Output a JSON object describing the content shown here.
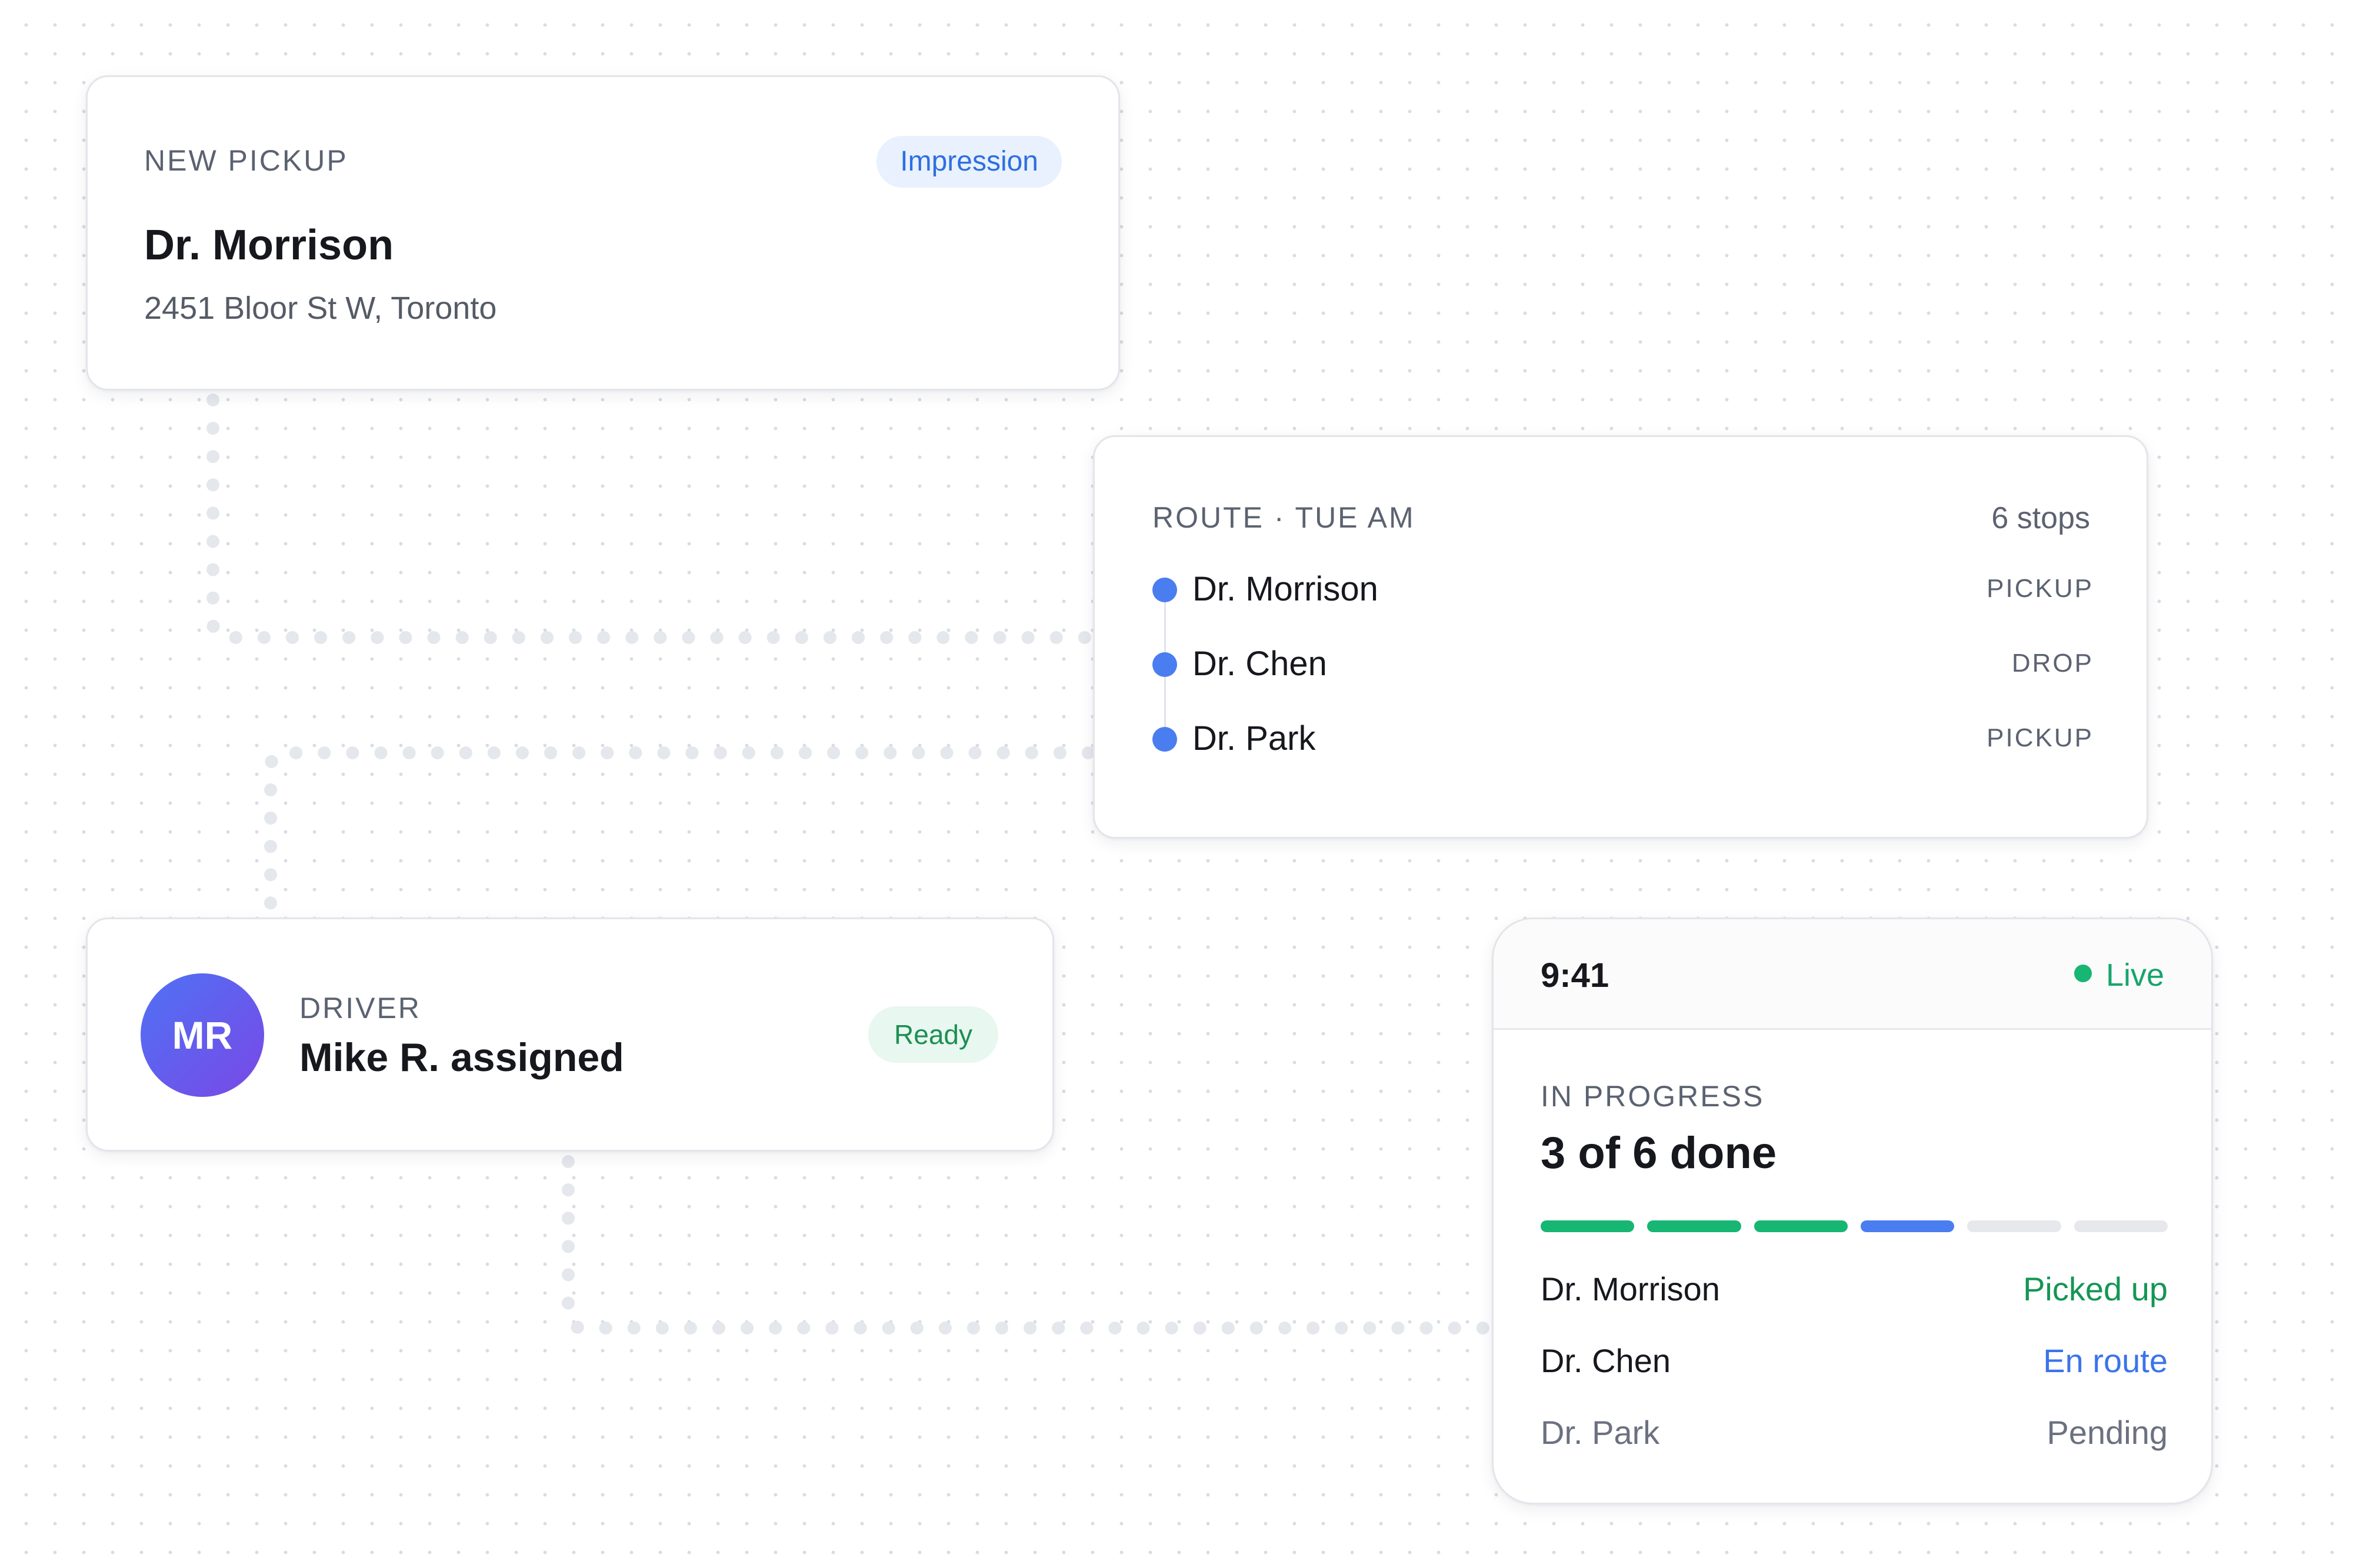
{
  "colors": {
    "accent_blue": "#4a7ef0",
    "success_green": "#17b673",
    "pill_blue_bg": "#e8f1fd",
    "pill_green_bg": "#e8f7ef",
    "avatar_gradient": [
      "#4e72f4",
      "#7a48e6"
    ]
  },
  "pickup_card": {
    "eyebrow": "NEW PICKUP",
    "badge": "Impression",
    "title": "Dr. Morrison",
    "address": "2451 Bloor St W, Toronto"
  },
  "route_card": {
    "eyebrow": "ROUTE · TUE AM",
    "count": "6 stops",
    "stops": [
      {
        "name": "Dr. Morrison",
        "type": "PICKUP"
      },
      {
        "name": "Dr. Chen",
        "type": "DROP"
      },
      {
        "name": "Dr. Park",
        "type": "PICKUP"
      }
    ]
  },
  "driver_card": {
    "avatar_initials": "MR",
    "eyebrow": "DRIVER",
    "title": "Mike R. assigned",
    "badge": "Ready"
  },
  "progress_card": {
    "time": "9:41",
    "live_label": "Live",
    "eyebrow": "IN PROGRESS",
    "title": "3 of 6 done",
    "progress": {
      "done": 3,
      "active": 1,
      "total": 6
    },
    "rows": [
      {
        "name": "Dr. Morrison",
        "status": "Picked up"
      },
      {
        "name": "Dr. Chen",
        "status": "En route"
      },
      {
        "name": "Dr. Park",
        "status": "Pending"
      }
    ]
  },
  "icons": [
    "stop-dot-icon",
    "live-dot-icon"
  ]
}
